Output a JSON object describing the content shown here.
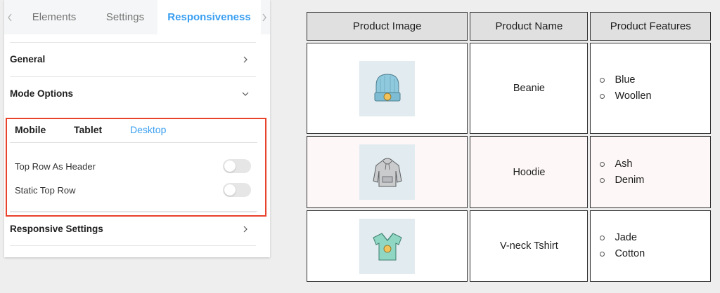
{
  "tabs": {
    "items": [
      "Elements",
      "Settings",
      "Responsiveness"
    ],
    "active": "Responsiveness"
  },
  "sections": {
    "general": "General",
    "mode_options": "Mode Options",
    "responsive_settings": "Responsive Settings"
  },
  "device_tabs": {
    "items": [
      "Mobile",
      "Tablet",
      "Desktop"
    ],
    "active": "Desktop"
  },
  "toggles": {
    "top_row_as_header": {
      "label": "Top Row As Header",
      "on": false
    },
    "static_top_row": {
      "label": "Static Top Row",
      "on": false
    }
  },
  "colors": {
    "accent": "#3a9ff0",
    "highlight_border": "#e8412c",
    "header_bg": "#e0e0e0"
  },
  "table": {
    "headers": [
      "Product Image",
      "Product Name",
      "Product Features"
    ],
    "rows": [
      {
        "image_icon": "beanie-icon",
        "name": "Beanie",
        "features": [
          "Blue",
          "Woollen"
        ]
      },
      {
        "image_icon": "hoodie-icon",
        "name": "Hoodie",
        "features": [
          "Ash",
          "Denim"
        ]
      },
      {
        "image_icon": "vneck-tshirt-icon",
        "name": "V-neck Tshirt",
        "features": [
          "Jade",
          "Cotton"
        ]
      }
    ]
  }
}
